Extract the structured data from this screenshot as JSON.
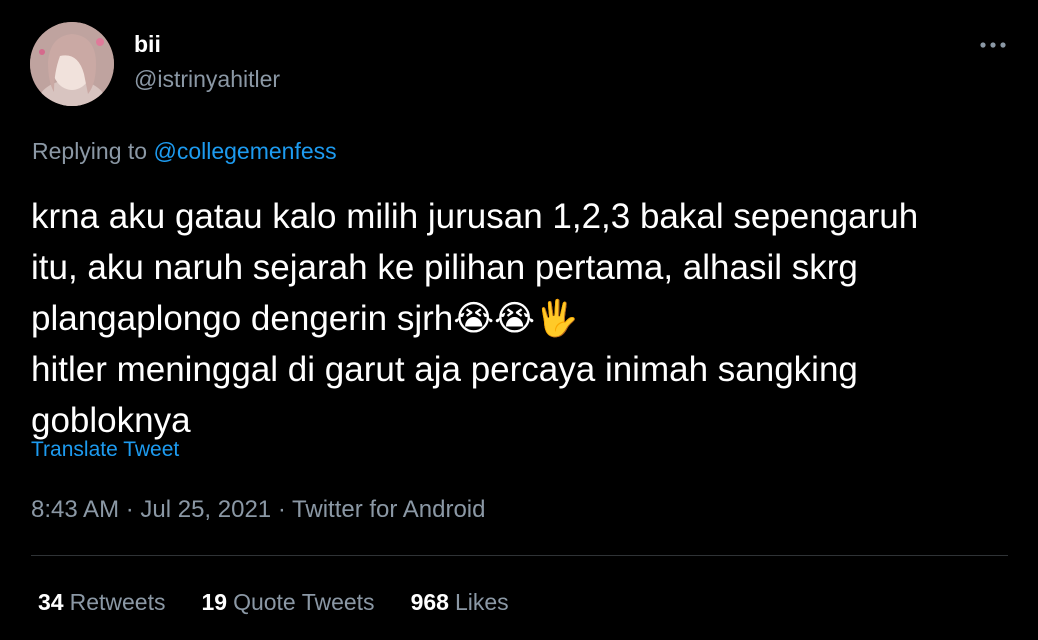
{
  "tweet": {
    "display_name": "bii",
    "handle": "@istrinyahitler",
    "reply_prefix": "Replying to",
    "reply_to": "@collegemenfess",
    "text": "krna aku gatau kalo milih jurusan 1,2,3 bakal sepengaruh\nitu, aku naruh sejarah ke pilihan pertama, alhasil skrg\nplangaplongo dengerin sjrh😭😭🖐️\nhitler meninggal di garut aja percaya inimah sangking\ngobloknya",
    "translate_label": "Translate Tweet",
    "timestamp": "8:43 AM · Jul 25, 2021 · Twitter for Android"
  },
  "stats": {
    "retweets": {
      "count": "34",
      "label": "Retweets"
    },
    "quote_tweets": {
      "count": "19",
      "label": "Quote Tweets"
    },
    "likes": {
      "count": "968",
      "label": "Likes"
    }
  },
  "icons": {
    "more": "more-horizontal-icon"
  },
  "colors": {
    "background": "#000000",
    "text": "#ffffff",
    "secondary": "#8b98a5",
    "link": "#1d9bf0",
    "divider": "#2f3336"
  }
}
